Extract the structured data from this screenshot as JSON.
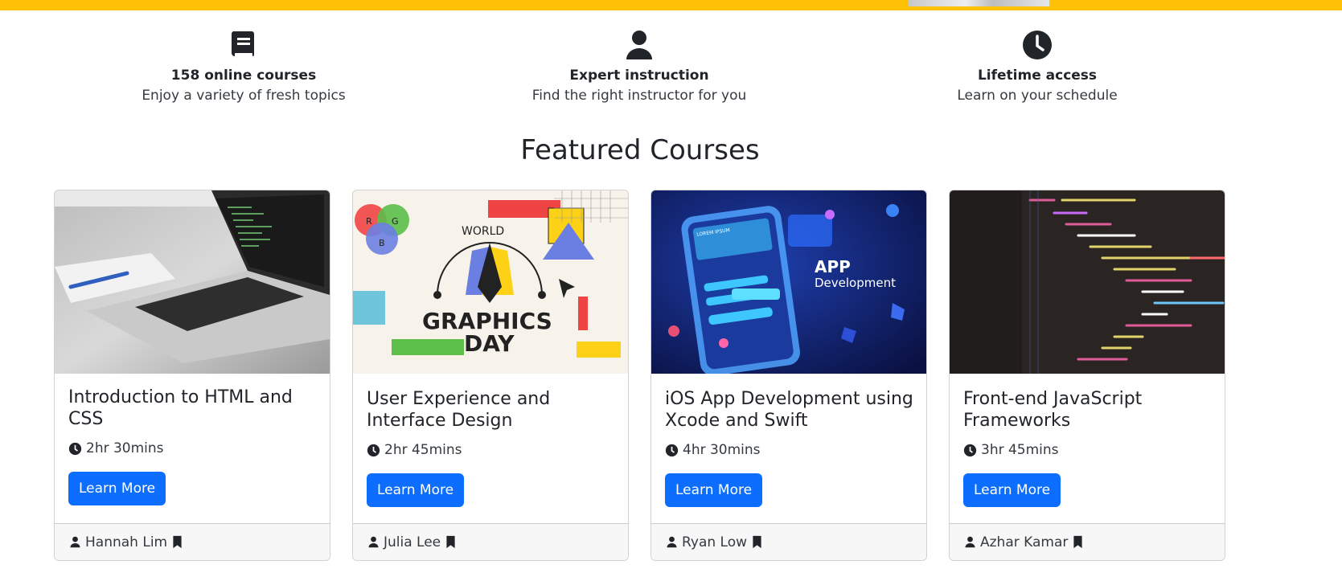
{
  "features": [
    {
      "icon": "book-icon",
      "title": "158 online courses",
      "subtitle": "Enjoy a variety of fresh topics"
    },
    {
      "icon": "user-icon",
      "title": "Expert instruction",
      "subtitle": "Find the right instructor for you"
    },
    {
      "icon": "clock-icon",
      "title": "Lifetime access",
      "subtitle": "Learn on your schedule"
    }
  ],
  "section_title": "Featured Courses",
  "courses": [
    {
      "title": "Introduction to HTML and CSS",
      "duration": "2hr 30mins",
      "button": "Learn More",
      "instructor": "Hannah Lim",
      "image": "laptop-photo"
    },
    {
      "title": "User Experience and Interface Design",
      "duration": "2hr 45mins",
      "button": "Learn More",
      "instructor": "Julia Lee",
      "image": "graphics-day-illustration"
    },
    {
      "title": "iOS App Development using Xcode and Swift",
      "duration": "4hr 30mins",
      "button": "Learn More",
      "instructor": "Ryan Low",
      "image": "app-development-illustration"
    },
    {
      "title": "Front-end JavaScript Frameworks",
      "duration": "3hr 45mins",
      "button": "Learn More",
      "instructor": "Azhar Kamar",
      "image": "code-screen-photo"
    }
  ],
  "image_text": {
    "graphics_world": "WORLD",
    "graphics_line1": "GRAPHICS",
    "graphics_line2": "DAY",
    "rgb_r": "R",
    "rgb_g": "G",
    "rgb_b": "B",
    "app_title": "APP",
    "app_subtitle": "Development",
    "app_screen_label": "LOREM IPSUM"
  },
  "colors": {
    "accent_yellow": "#ffc107",
    "primary_button": "#0d6efd",
    "text_dark": "#212529"
  }
}
